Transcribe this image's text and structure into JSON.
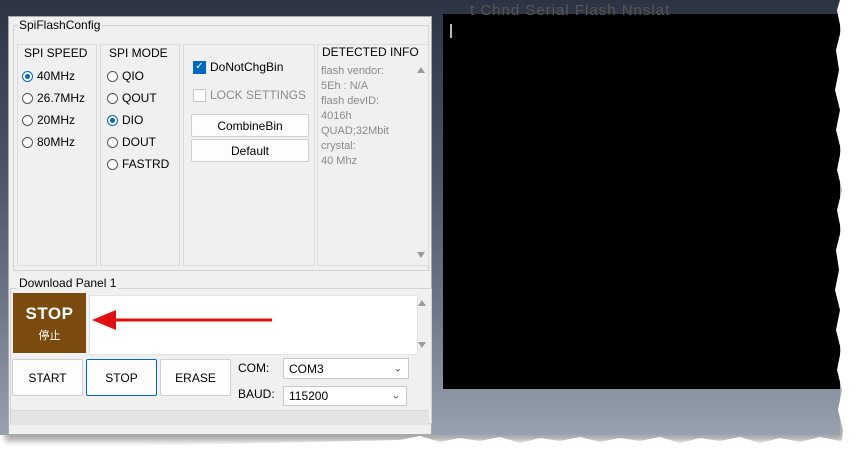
{
  "window": {
    "title": "SpiFlashConfig"
  },
  "background": {
    "text": "t Chnd Serial Flash Nnslat"
  },
  "spi_speed": {
    "header": "SPI SPEED",
    "options": [
      {
        "label": "40MHz",
        "selected": true
      },
      {
        "label": "26.7MHz",
        "selected": false
      },
      {
        "label": "20MHz",
        "selected": false
      },
      {
        "label": "80MHz",
        "selected": false
      }
    ]
  },
  "spi_mode": {
    "header": "SPI MODE",
    "options": [
      {
        "label": "QIO",
        "selected": false
      },
      {
        "label": "QOUT",
        "selected": false
      },
      {
        "label": "DIO",
        "selected": true
      },
      {
        "label": "DOUT",
        "selected": false
      },
      {
        "label": "FASTRD",
        "selected": false
      }
    ]
  },
  "options": {
    "do_not_chg_bin": {
      "label": "DoNotChgBin",
      "checked": true
    },
    "lock_settings": {
      "label": "LOCK SETTINGS",
      "checked": false,
      "enabled": false
    },
    "combine_bin_label": "CombineBin",
    "default_label": "Default"
  },
  "detected_info": {
    "header": "DETECTED INFO",
    "lines": [
      "flash vendor:",
      "5Eh : N/A",
      "flash devID:",
      "4016h",
      "QUAD;32Mbit",
      "crystal:",
      "40 Mhz"
    ]
  },
  "download_panel": {
    "title": "Download Panel 1",
    "status_tile": {
      "big": "STOP",
      "small": "停止",
      "color": "#7a4a0e"
    }
  },
  "buttons": {
    "start": "START",
    "stop": "STOP",
    "erase": "ERASE"
  },
  "com": {
    "label": "COM:",
    "value": "COM3"
  },
  "baud": {
    "label": "BAUD:",
    "value": "115200"
  },
  "colors": {
    "accent": "#0067c0",
    "annotation_arrow": "#e01010"
  },
  "icons": {
    "checkbox": "check-icon",
    "scroll_up": "triangle-up-icon",
    "scroll_down": "triangle-down-icon",
    "dropdown": "chevron-down-icon",
    "annotation": "arrow-left-icon"
  }
}
